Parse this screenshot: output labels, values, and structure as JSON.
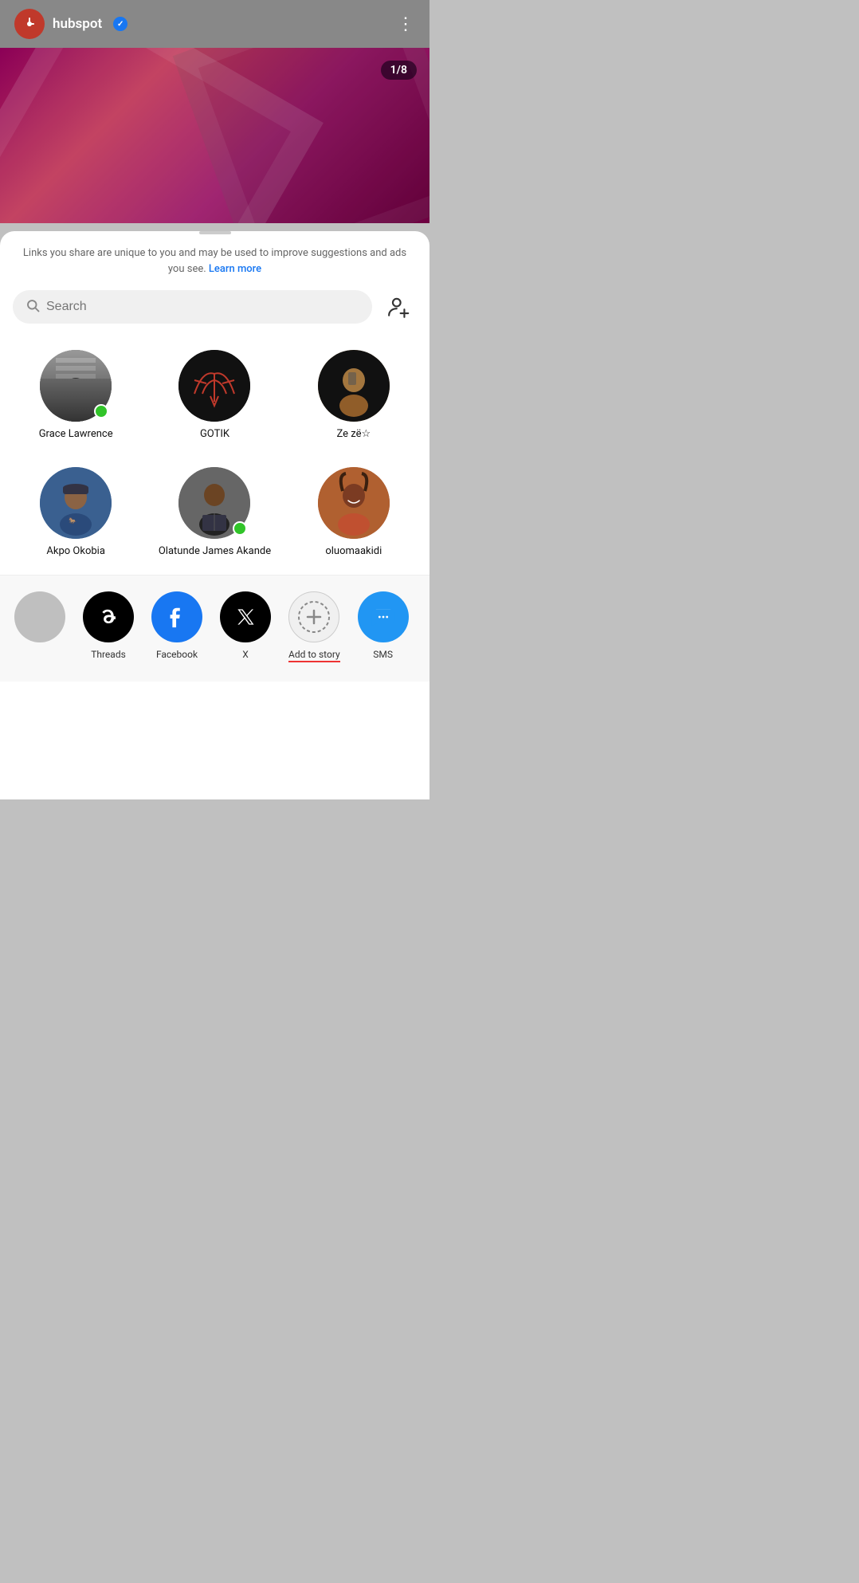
{
  "topbar": {
    "brand": "hubspot",
    "verified": true,
    "menu_icon": "⋮"
  },
  "hero": {
    "counter": "1/8"
  },
  "sheet": {
    "privacy_text": "Links you share are unique to you and may be used to improve suggestions and ads you see.",
    "learn_more": "Learn more",
    "search_placeholder": "Search"
  },
  "contacts": [
    {
      "name": "Grace Lawrence",
      "online": true,
      "avatar_class": "av-grace"
    },
    {
      "name": "GOTIK",
      "online": false,
      "avatar_class": "av-gotik"
    },
    {
      "name": "Ze zë☆",
      "online": false,
      "avatar_class": "av-zeze"
    },
    {
      "name": "Akpo Okobia",
      "online": false,
      "avatar_class": "av-akpo"
    },
    {
      "name": "Olatunde James Akande",
      "online": true,
      "avatar_class": "av-olatunde"
    },
    {
      "name": "oluomaakidi",
      "online": false,
      "avatar_class": "av-oluoma"
    }
  ],
  "share_options": [
    {
      "id": "threads",
      "label": "Threads",
      "color_class": "threads-color",
      "icon": "threads"
    },
    {
      "id": "facebook",
      "label": "Facebook",
      "color_class": "facebook-color",
      "icon": "facebook"
    },
    {
      "id": "x",
      "label": "X",
      "color_class": "x-color",
      "icon": "x"
    },
    {
      "id": "add-to-story",
      "label": "Add to story",
      "color_class": "story-color",
      "icon": "story",
      "underline": true
    },
    {
      "id": "sms",
      "label": "SMS",
      "color_class": "sms-color",
      "icon": "sms"
    }
  ]
}
